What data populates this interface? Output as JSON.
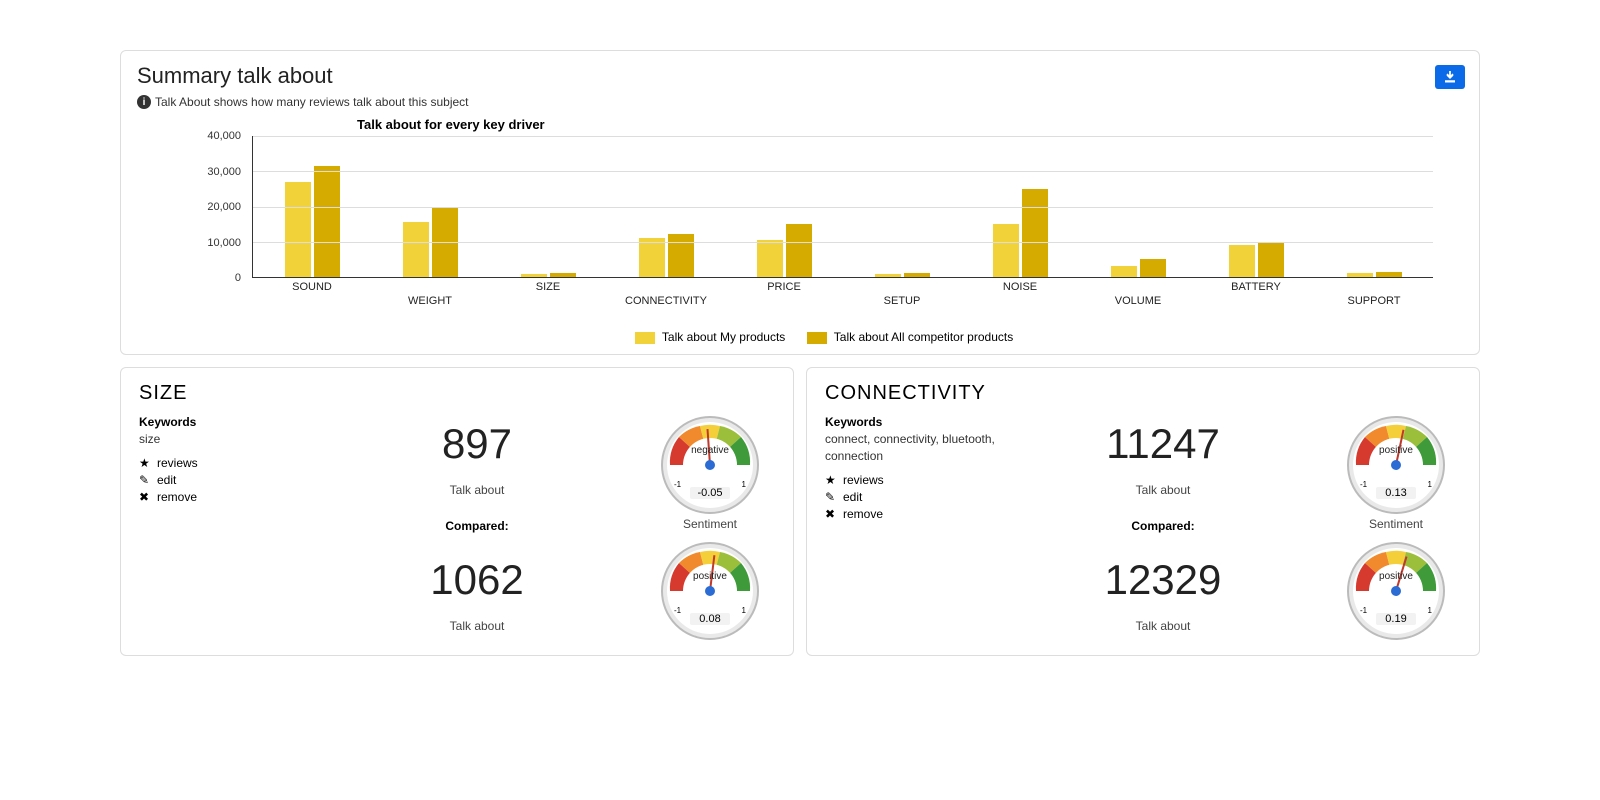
{
  "summary": {
    "title": "Summary talk about",
    "subtitle": "Talk About shows how many reviews talk about this subject",
    "download_label": "download"
  },
  "chart_data": {
    "type": "bar",
    "title": "Talk about for every key driver",
    "categories": [
      "SOUND",
      "WEIGHT",
      "SIZE",
      "CONNECTIVITY",
      "PRICE",
      "SETUP",
      "NOISE",
      "VOLUME",
      "BATTERY",
      "SUPPORT"
    ],
    "series": [
      {
        "name": "Talk about My products",
        "color": "#f2d239",
        "values": [
          27000,
          15500,
          900,
          11200,
          10500,
          800,
          15000,
          3000,
          9000,
          1200
        ]
      },
      {
        "name": "Talk about All competitor products",
        "color": "#d6ab00",
        "values": [
          31500,
          19500,
          1100,
          12300,
          15000,
          1200,
          25000,
          5000,
          10000,
          1500
        ]
      }
    ],
    "yticks": [
      0,
      10000,
      20000,
      30000,
      40000
    ],
    "ytick_labels": [
      "0",
      "10,000",
      "20,000",
      "30,000",
      "40,000"
    ],
    "ylim": [
      0,
      40000
    ],
    "xlabel": "",
    "ylabel": ""
  },
  "legend": {
    "a": "Talk about My products",
    "b": "Talk about All competitor products"
  },
  "cards": {
    "left": {
      "title": "SIZE",
      "kw_head": "Keywords",
      "kw_list": "size",
      "actions": {
        "reviews": "reviews",
        "edit": "edit",
        "remove": "remove"
      },
      "value": "897",
      "talk_label": "Talk about",
      "compared": "Compared:",
      "compared_value": "1062",
      "gauge1": {
        "word": "negative",
        "value": "-0.05",
        "min": "-1",
        "max": "1",
        "sent_label": "Sentiment",
        "needle_deg": -4
      },
      "gauge2": {
        "word": "positive",
        "value": "0.08",
        "min": "-1",
        "max": "1",
        "needle_deg": 7
      }
    },
    "right": {
      "title": "CONNECTIVITY",
      "kw_head": "Keywords",
      "kw_list": "connect, connectivity, bluetooth, connection",
      "actions": {
        "reviews": "reviews",
        "edit": "edit",
        "remove": "remove"
      },
      "value": "11247",
      "talk_label": "Talk about",
      "compared": "Compared:",
      "compared_value": "12329",
      "gauge1": {
        "word": "positive",
        "value": "0.13",
        "min": "-1",
        "max": "1",
        "sent_label": "Sentiment",
        "needle_deg": 12
      },
      "gauge2": {
        "word": "positive",
        "value": "0.19",
        "min": "-1",
        "max": "1",
        "needle_deg": 17
      }
    }
  }
}
